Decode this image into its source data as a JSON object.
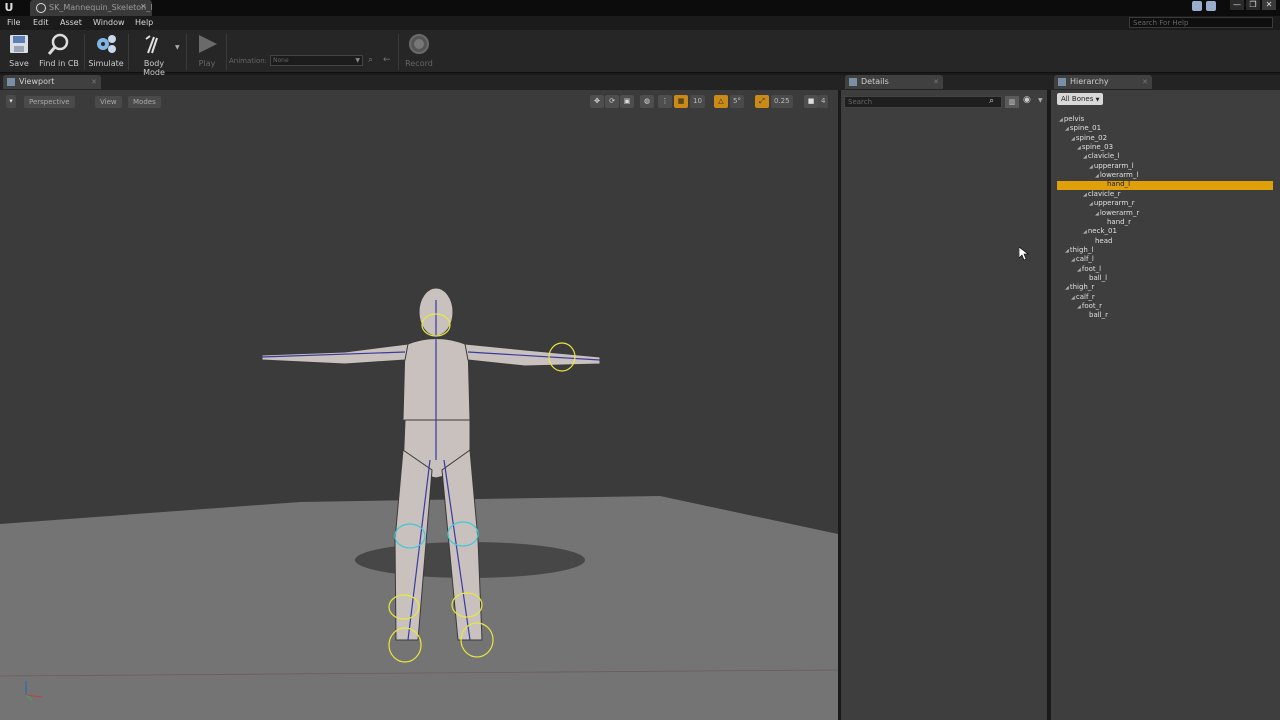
{
  "app": {
    "logo": "U",
    "document_tab": "SK_Mannequin_Skeleton_l",
    "window_buttons": [
      "—",
      "❐",
      "✕"
    ],
    "search_help_placeholder": "Search For Help"
  },
  "menu": [
    "File",
    "Edit",
    "Asset",
    "Window",
    "Help"
  ],
  "toolbar": {
    "save": "Save",
    "find_in_cb": "Find in CB",
    "simulate": "Simulate",
    "body_mode": "Body Mode",
    "play": "Play",
    "animation_label": "Animation:",
    "animation_value": "None",
    "record": "Record"
  },
  "viewport": {
    "tab": "Viewport",
    "perspective": "Perspective",
    "view": "View",
    "modes": "Modes",
    "grid_snap": "10",
    "rotation_snap": "5°",
    "scale_snap": "0.25",
    "camera_speed": "4"
  },
  "details": {
    "tab": "Details",
    "search_placeholder": "Search"
  },
  "hierarchy": {
    "tab": "Hierarchy",
    "filter": "All Bones",
    "bones": [
      {
        "name": "pelvis",
        "expandable": true
      },
      {
        "name": "spine_01",
        "expandable": true
      },
      {
        "name": "spine_02",
        "expandable": true
      },
      {
        "name": "spine_03",
        "expandable": true
      },
      {
        "name": "clavicle_l",
        "expandable": true
      },
      {
        "name": "upperarm_l",
        "expandable": true
      },
      {
        "name": "lowerarm_l",
        "expandable": true
      },
      {
        "name": "hand_l",
        "expandable": false,
        "selected": true
      },
      {
        "name": "clavicle_r",
        "expandable": true
      },
      {
        "name": "upperarm_r",
        "expandable": true
      },
      {
        "name": "lowerarm_r",
        "expandable": true
      },
      {
        "name": "hand_r",
        "expandable": false
      },
      {
        "name": "neck_01",
        "expandable": true
      },
      {
        "name": "head",
        "expandable": false
      },
      {
        "name": "thigh_l",
        "expandable": true
      },
      {
        "name": "calf_l",
        "expandable": true
      },
      {
        "name": "foot_l",
        "expandable": true
      },
      {
        "name": "ball_l",
        "expandable": false
      },
      {
        "name": "thigh_r",
        "expandable": true
      },
      {
        "name": "calf_r",
        "expandable": true
      },
      {
        "name": "foot_r",
        "expandable": true
      },
      {
        "name": "ball_r",
        "expandable": false
      }
    ]
  },
  "colors": {
    "selection": "#e0a00a",
    "physics_body_selected": "#e8e840",
    "physics_body": "#40c8d8",
    "panel_bg": "#3e3e3e"
  }
}
